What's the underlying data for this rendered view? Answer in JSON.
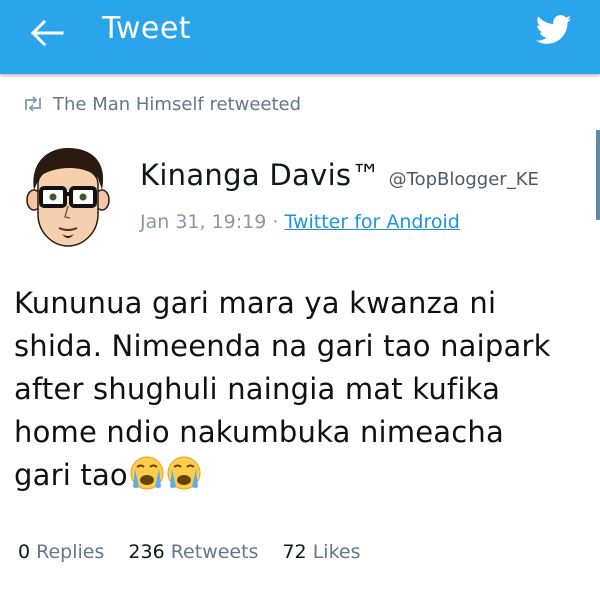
{
  "header": {
    "title": "Tweet",
    "back_icon": "arrow-left-icon",
    "logo_icon": "twitter-bird-icon",
    "bar_color": "#2aa4ea"
  },
  "retweet_context": {
    "icon": "retweet-icon",
    "text": "The Man Himself retweeted"
  },
  "author": {
    "name": "Kinanga Davis™",
    "handle": "@TopBlogger_KE",
    "avatar": "cartoon-avatar-with-glasses"
  },
  "meta": {
    "date": "Jan 31, 19:19",
    "separator": "·",
    "source": "Twitter for Android"
  },
  "tweet": {
    "lines": [
      "Kununua gari mara ya kwanza ni",
      "shida. Nimeenda na gari tao naipark",
      "after shughuli naingia mat kufika",
      "home ndio nakumbuka nimeacha",
      "gari tao"
    ],
    "emoji": "loudly-crying-face-icon"
  },
  "stats": {
    "replies_count": "0",
    "replies_label": "Replies",
    "retweets_count": "236",
    "retweets_label": "Retweets",
    "likes_count": "72",
    "likes_label": "Likes"
  }
}
